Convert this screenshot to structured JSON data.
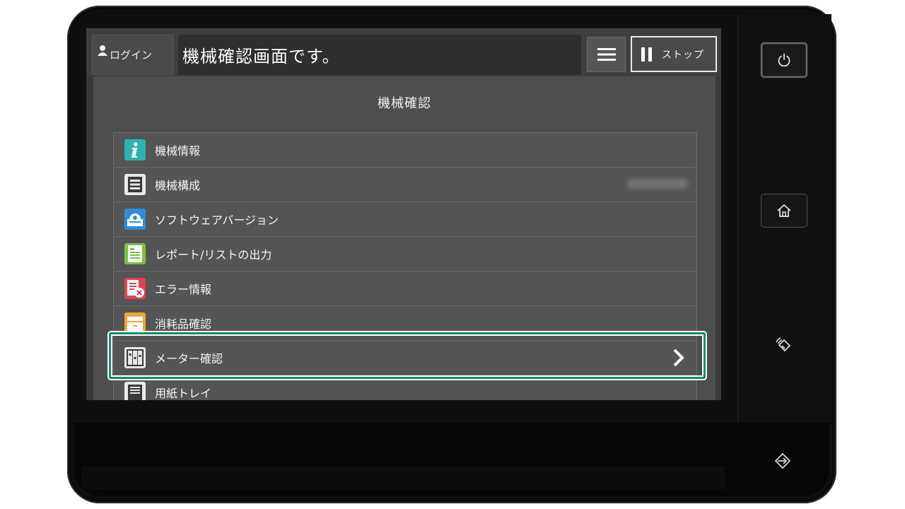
{
  "header": {
    "login_label": "ログイン",
    "message": "機械確認画面です。",
    "stop_label": "ストップ"
  },
  "page": {
    "title": "機械確認"
  },
  "menu_items": [
    {
      "label": "機械情報",
      "icon": "info-icon"
    },
    {
      "label": "機械構成",
      "icon": "machine-config-icon"
    },
    {
      "label": "ソフトウェアバージョン",
      "icon": "software-icon"
    },
    {
      "label": "レポート/リストの出力",
      "icon": "report-icon"
    },
    {
      "label": "エラー情報",
      "icon": "error-icon"
    },
    {
      "label": "消耗品確認",
      "icon": "supplies-icon"
    },
    {
      "label": "メーター確認",
      "icon": "meter-icon",
      "selected": true
    },
    {
      "label": "用紙トレイ",
      "icon": "paper-tray-icon"
    }
  ],
  "colors": {
    "highlight": "#0e8d6a",
    "info_icon": "#2bb3b1",
    "software_icon": "#2a8fd6",
    "report_icon": "#7bc142",
    "error_icon": "#e0424f",
    "supplies_icon": "#f2a531"
  }
}
